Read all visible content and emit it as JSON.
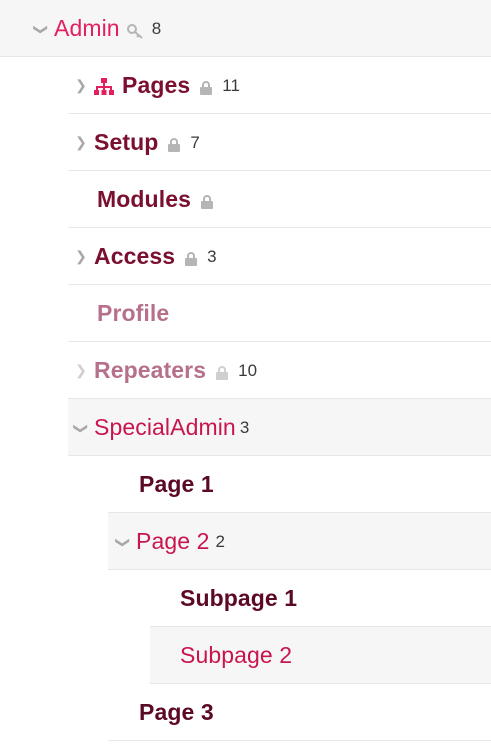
{
  "tree": {
    "admin": {
      "label": "Admin",
      "count": "8"
    },
    "pages": {
      "label": "Pages",
      "count": "11"
    },
    "setup": {
      "label": "Setup",
      "count": "7"
    },
    "modules": {
      "label": "Modules"
    },
    "access": {
      "label": "Access",
      "count": "3"
    },
    "profile": {
      "label": "Profile"
    },
    "repeaters": {
      "label": "Repeaters",
      "count": "10"
    },
    "special_admin": {
      "label": "SpecialAdmin",
      "count": "3"
    },
    "page1": {
      "label": "Page 1"
    },
    "page2": {
      "label": "Page 2",
      "count": "2"
    },
    "subpage1": {
      "label": "Subpage 1"
    },
    "subpage2": {
      "label": "Subpage 2"
    },
    "page3": {
      "label": "Page 3"
    }
  },
  "icons": {
    "expand": "chevron-right-icon",
    "collapse": "chevron-down-icon",
    "locked": "lock-icon",
    "key": "key-icon",
    "sitemap": "sitemap-icon"
  },
  "colors": {
    "dark_link": "#7a0f30",
    "active_link": "#e3205f",
    "open_link": "#c9154e",
    "faded_link": "#b6708c",
    "icon_gray": "#b5b5b5",
    "selected_bg": "#f6f6f7"
  }
}
